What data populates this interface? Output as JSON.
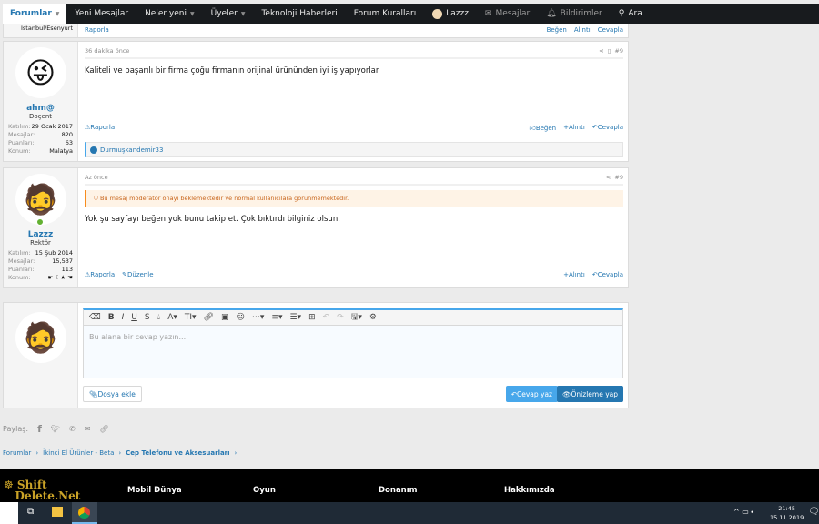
{
  "nav": {
    "items": [
      {
        "label": "Forumlar",
        "caret": true
      },
      {
        "label": "Yeni Mesajlar"
      },
      {
        "label": "Neler yeni",
        "caret": true
      },
      {
        "label": "Üyeler",
        "caret": true
      },
      {
        "label": "Teknoloji Haberleri"
      },
      {
        "label": "Forum Kuralları"
      }
    ],
    "user": "Lazzz",
    "messages": "Mesajlar",
    "alerts": "Bildirimler",
    "search": "Ara"
  },
  "prev_post": {
    "location": "İstanbul/Esenyurt",
    "report": "Raporla",
    "like": "Beğen",
    "quote": "Alıntı",
    "reply": "Cevapla"
  },
  "posts": [
    {
      "time": "36 dakika önce",
      "number": "#9",
      "user": "ahm@",
      "title": "Doçent",
      "stats": [
        [
          "Katılım:",
          "29 Ocak 2017"
        ],
        [
          "Mesajlar:",
          "820"
        ],
        [
          "Puanları:",
          "63"
        ],
        [
          "Konum:",
          "Malatya"
        ]
      ],
      "text": "Kaliteli ve başarılı bir firma çoğu firmanın orijinal ürününden iyi iş yapıyorlar",
      "report": "Raporla",
      "like": "Beğen",
      "quote": "Alıntı",
      "reply": "Cevapla",
      "liked_by": "Durmuşkandemir33"
    },
    {
      "time": "Az önce",
      "number": "#9",
      "user": "Lazzz",
      "title": "Rektör",
      "stats": [
        [
          "Katılım:",
          "15 Şub 2014"
        ],
        [
          "Mesajlar:",
          "15,537"
        ],
        [
          "Puanları:",
          "113"
        ],
        [
          "Konum:",
          "☛ ☾★ ☚"
        ]
      ],
      "warning": "Bu mesaj moderatör onayı beklemektedir ve normal kullanıcılara görünmemektedir.",
      "text": "Yok şu sayfayı beğen yok bunu takip et. Çok bıktırdı bilginiz olsun.",
      "report": "Raporla",
      "edit": "Düzenle",
      "quote": "Alıntı",
      "reply": "Cevapla"
    }
  ],
  "reply": {
    "placeholder": "Bu alana bir cevap yazın...",
    "attach": "Dosya ekle",
    "submit": "Cevap yaz",
    "preview": "Önizleme yap"
  },
  "share_label": "Paylaş:",
  "breadcrumb": [
    "Forumlar",
    "İkinci El Ürünler - Beta",
    "Cep Telefonu ve Aksesuarları"
  ],
  "footer": {
    "logo": "Shift Delete.Net",
    "cols": [
      "Mobil Dünya",
      "Oyun",
      "Donanım",
      "Hakkımızda"
    ]
  },
  "taskbar": {
    "time": "21:45",
    "date": "15.11.2019"
  }
}
